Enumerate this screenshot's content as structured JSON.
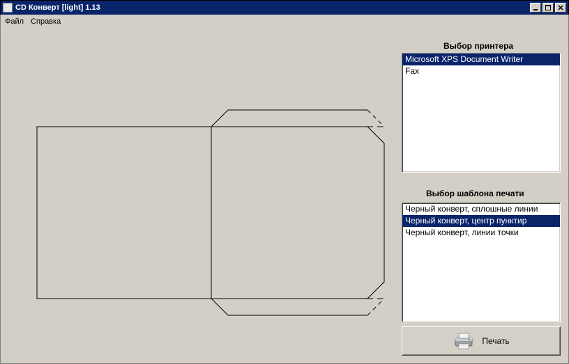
{
  "window": {
    "title": "CD Конверт [light] 1.13"
  },
  "menu": {
    "file": "Файл",
    "help": "Справка"
  },
  "labels": {
    "printer": "Выбор принтера",
    "template": "Выбор шаблона печати"
  },
  "printers": {
    "items": [
      {
        "label": "Microsoft XPS Document Writer",
        "selected": true
      },
      {
        "label": "Fax",
        "selected": false
      }
    ]
  },
  "templates": {
    "items": [
      {
        "label": "Черный конверт, сплошные линии",
        "selected": false
      },
      {
        "label": "Черный конверт, центр пунктир",
        "selected": true
      },
      {
        "label": "Черный конверт, линии точки",
        "selected": false
      }
    ]
  },
  "buttons": {
    "print": "Печать"
  }
}
